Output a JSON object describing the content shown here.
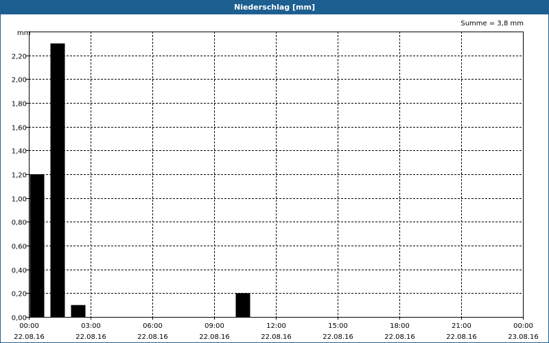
{
  "window": {
    "title": "Niederschlag [mm]"
  },
  "chart_data": {
    "type": "bar",
    "title": "Niederschlag [mm]",
    "ylabel": "mm",
    "summary": "Summe = 3,8 mm",
    "ylim": [
      0,
      2.4
    ],
    "xlim_hours": [
      0,
      24
    ],
    "y_ticks": [
      "0,00",
      "0,20",
      "0,40",
      "0,60",
      "0,80",
      "1,00",
      "1,20",
      "1,40",
      "1,60",
      "1,80",
      "2,00",
      "2,20"
    ],
    "x_ticks": [
      {
        "time": "00:00",
        "date": "22.08.16"
      },
      {
        "time": "03:00",
        "date": "22.08.16"
      },
      {
        "time": "06:00",
        "date": "22.08.16"
      },
      {
        "time": "09:00",
        "date": "22.08.16"
      },
      {
        "time": "12:00",
        "date": "22.08.16"
      },
      {
        "time": "15:00",
        "date": "22.08.16"
      },
      {
        "time": "18:00",
        "date": "22.08.16"
      },
      {
        "time": "21:00",
        "date": "22.08.16"
      },
      {
        "time": "00:00",
        "date": "23.08.16"
      }
    ],
    "grid": true,
    "bar_color": "#000000",
    "bars": [
      {
        "start": "00:00",
        "end": "01:00",
        "value": 1.2
      },
      {
        "start": "01:00",
        "end": "02:00",
        "value": 2.3
      },
      {
        "start": "02:00",
        "end": "03:00",
        "value": 0.1
      },
      {
        "start": "10:00",
        "end": "11:00",
        "value": 0.2
      }
    ]
  }
}
